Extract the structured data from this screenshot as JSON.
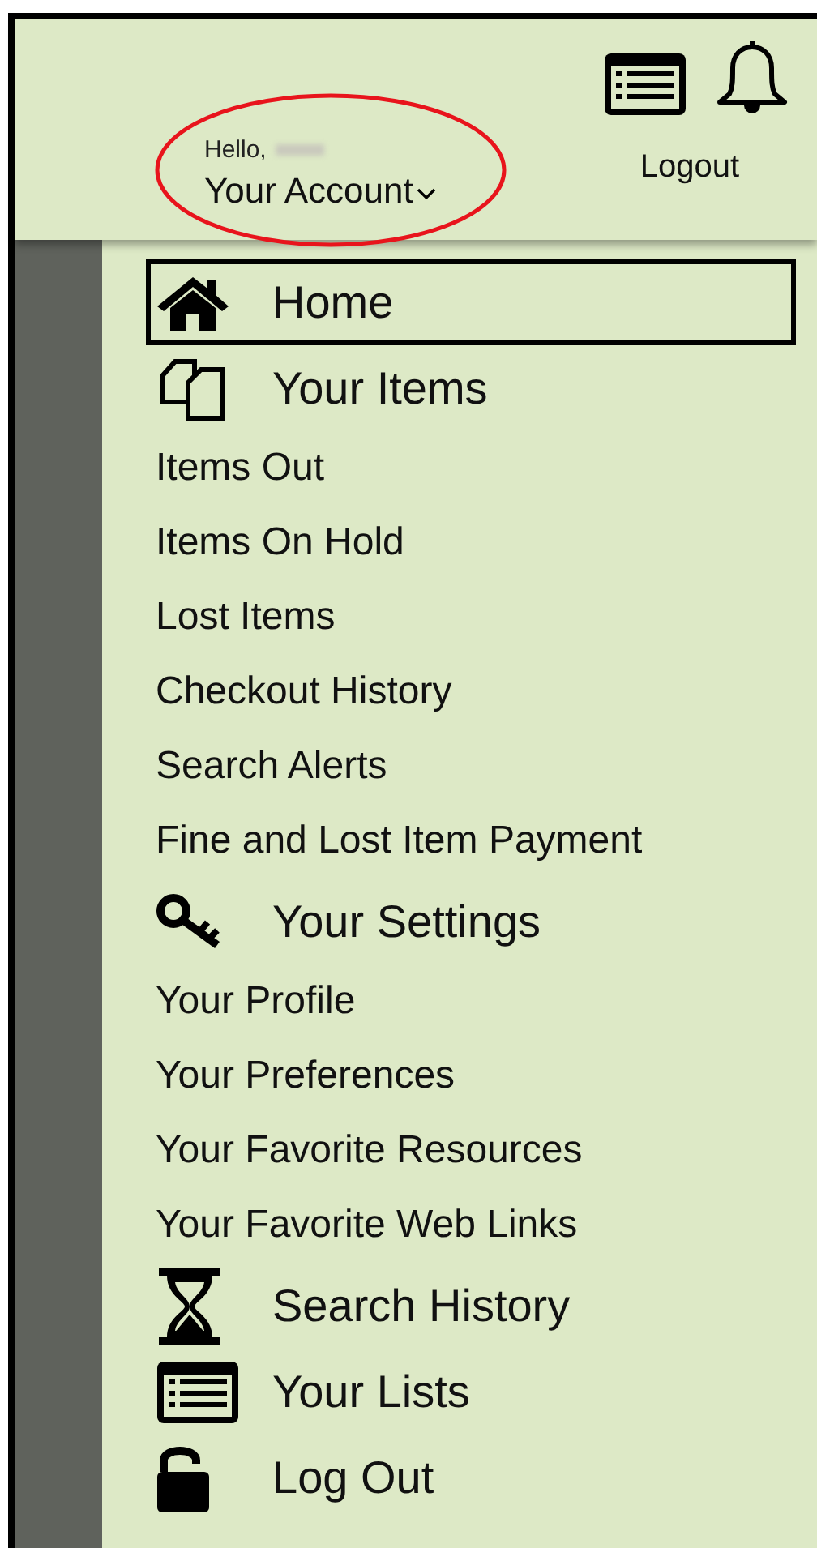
{
  "header": {
    "greeting": "Hello,",
    "account": "Your Account",
    "logout": "Logout",
    "annotation": {
      "color": "#e8141c"
    }
  },
  "menu": [
    {
      "kind": "home",
      "label": "Home",
      "selected": true
    },
    {
      "kind": "items",
      "label": "Your Items",
      "selected": false
    },
    {
      "kind": "link",
      "label": "Items Out",
      "selected": false
    },
    {
      "kind": "link",
      "label": "Items On Hold",
      "selected": false
    },
    {
      "kind": "link",
      "label": "Lost Items",
      "selected": false
    },
    {
      "kind": "link",
      "label": "Checkout History",
      "selected": false
    },
    {
      "kind": "link",
      "label": "Search Alerts",
      "selected": false
    },
    {
      "kind": "link",
      "label": "Fine and Lost Item Payment",
      "selected": false
    },
    {
      "kind": "settings",
      "label": "Your Settings",
      "selected": false
    },
    {
      "kind": "link",
      "label": "Your Profile",
      "selected": false
    },
    {
      "kind": "link",
      "label": "Your Preferences",
      "selected": false
    },
    {
      "kind": "link",
      "label": "Your Favorite Resources",
      "selected": false
    },
    {
      "kind": "link",
      "label": "Your Favorite Web Links",
      "selected": false
    },
    {
      "kind": "history",
      "label": "Search History",
      "selected": false
    },
    {
      "kind": "lists",
      "label": "Your Lists",
      "selected": false
    },
    {
      "kind": "logout",
      "label": "Log Out",
      "selected": false
    }
  ]
}
